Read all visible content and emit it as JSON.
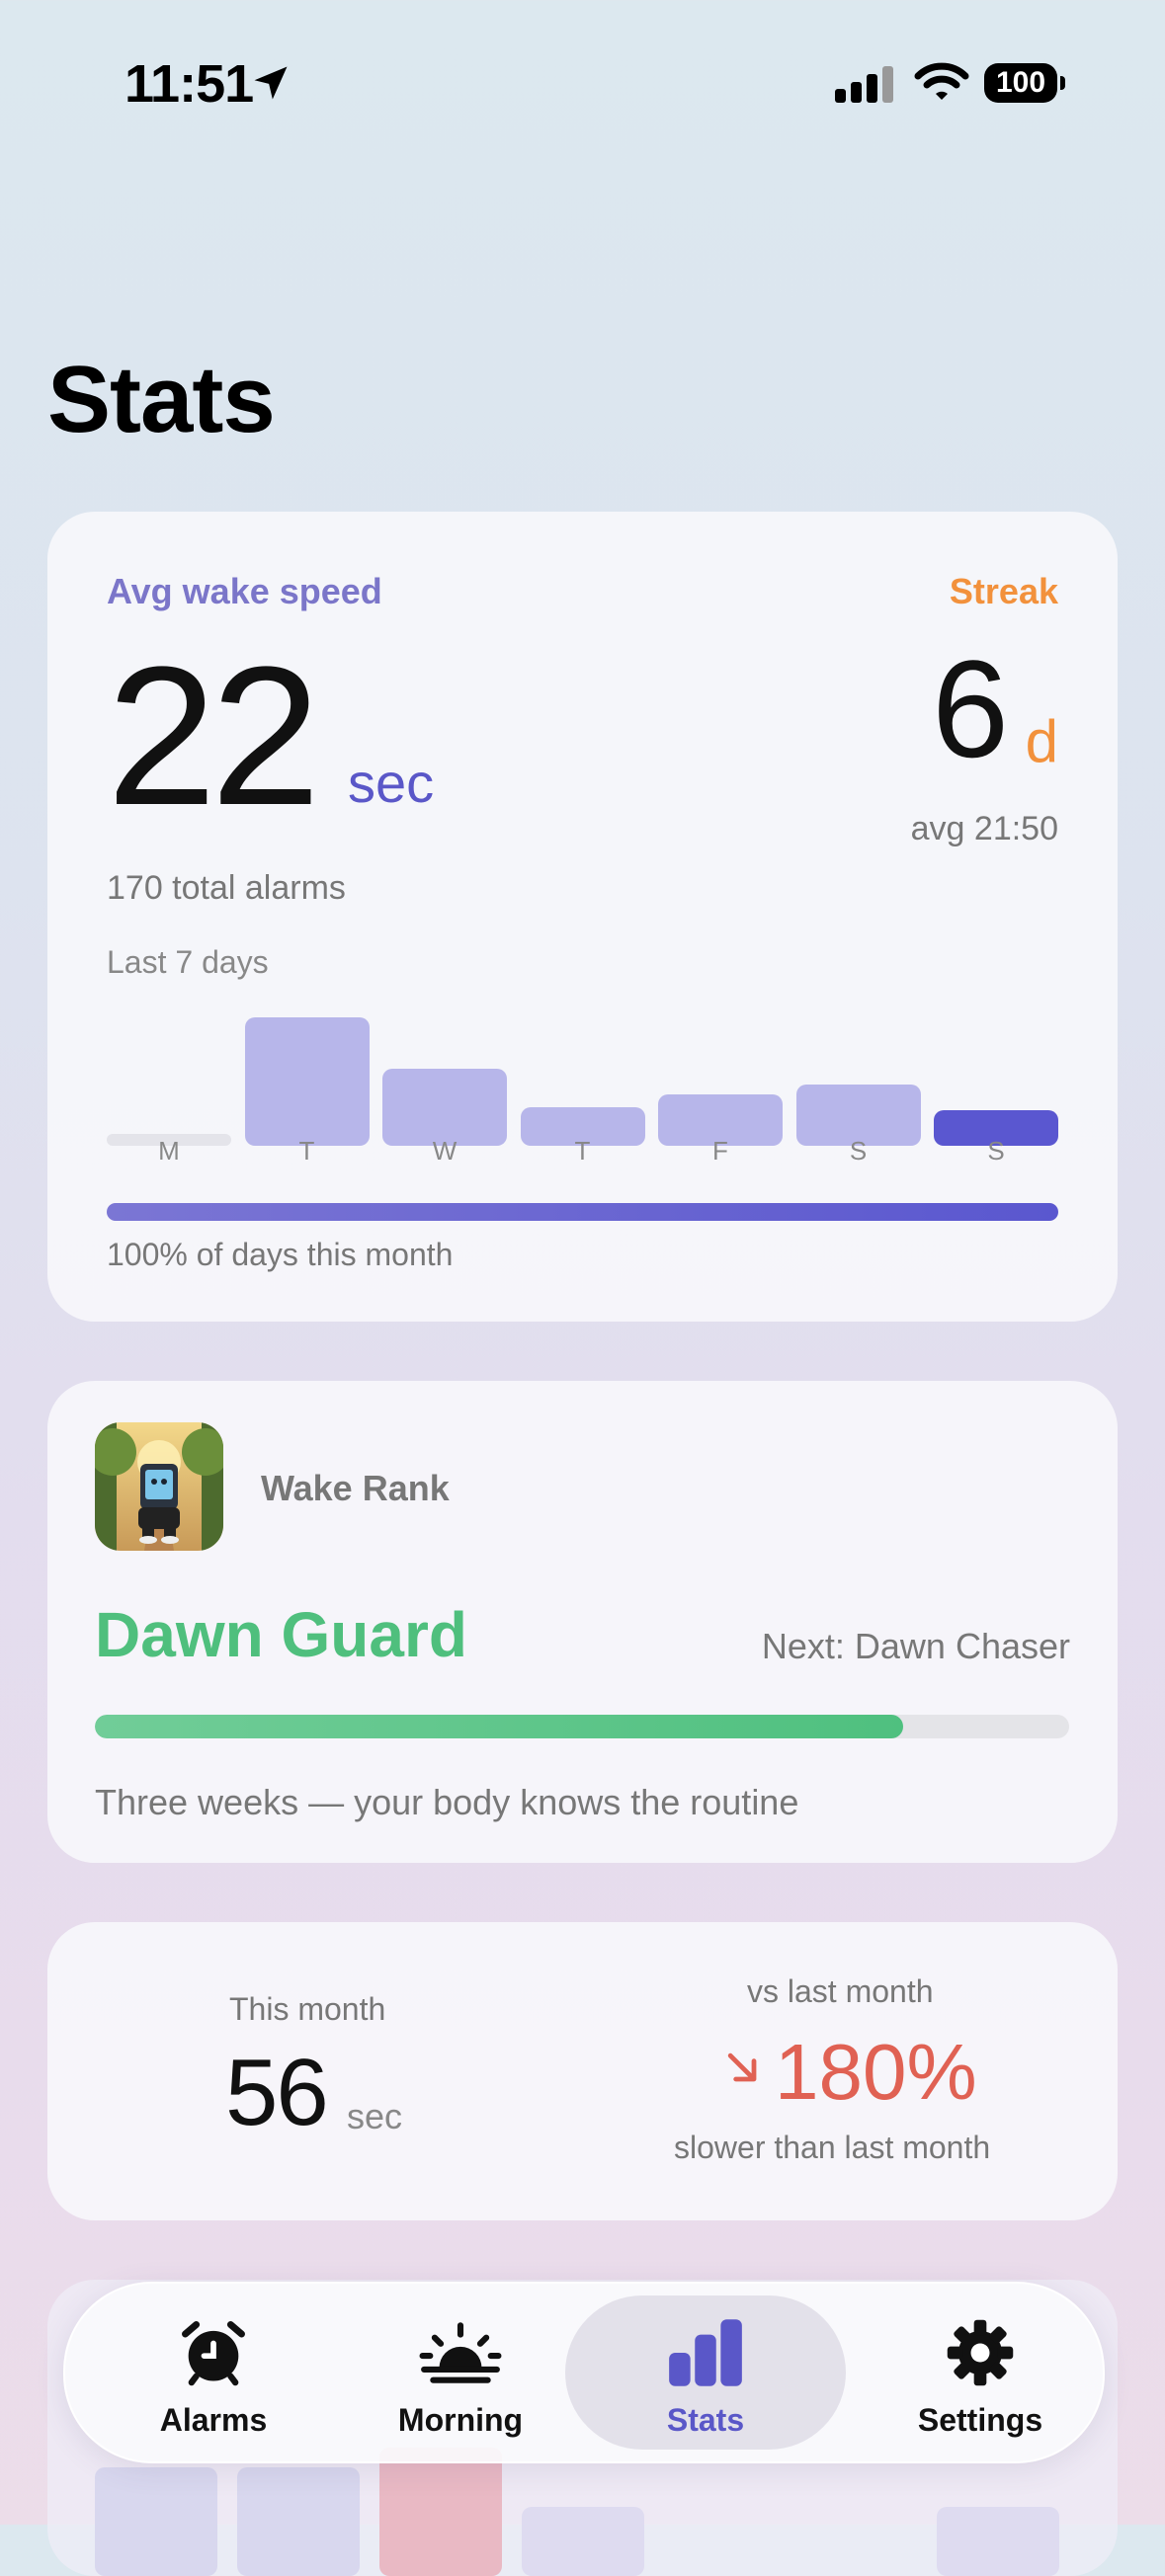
{
  "status_bar": {
    "time": "11:51",
    "battery": "100"
  },
  "page_title": "Stats",
  "speed_card": {
    "avg_label": "Avg wake speed",
    "avg_value": "22",
    "avg_unit": "sec",
    "streak_label": "Streak",
    "streak_value": "6",
    "streak_unit": "d",
    "streak_avg": "avg 21:50",
    "total_alarms": "170 total alarms",
    "chart_title": "Last 7 days",
    "days": [
      "M",
      "T",
      "W",
      "T",
      "F",
      "S",
      "S"
    ],
    "bar_levels": [
      0,
      1.0,
      0.6,
      0.3,
      0.4,
      0.48,
      0.28
    ],
    "month_progress": 1.0,
    "month_text": "100% of days this month"
  },
  "rank_card": {
    "label": "Wake Rank",
    "rank_name": "Dawn Guard",
    "next": "Next: Dawn Chaser",
    "progress": 0.83,
    "message": "Three weeks — your body knows the routine"
  },
  "month_card": {
    "this_month_label": "This month",
    "this_month_value": "56",
    "this_month_unit": "sec",
    "vs_label": "vs last month",
    "vs_value": "180%",
    "vs_desc": "slower than last month"
  },
  "tab_bar": {
    "tabs": [
      {
        "label": "Alarms",
        "icon": "alarm-clock-icon"
      },
      {
        "label": "Morning",
        "icon": "sunrise-icon"
      },
      {
        "label": "Stats",
        "icon": "bar-chart-icon"
      },
      {
        "label": "Settings",
        "icon": "gear-icon"
      }
    ],
    "active": "Stats"
  },
  "colors": {
    "accent": "#5a57c8",
    "streak": "#f2913c",
    "rank": "#4fbf7d",
    "negative": "#e06153"
  }
}
